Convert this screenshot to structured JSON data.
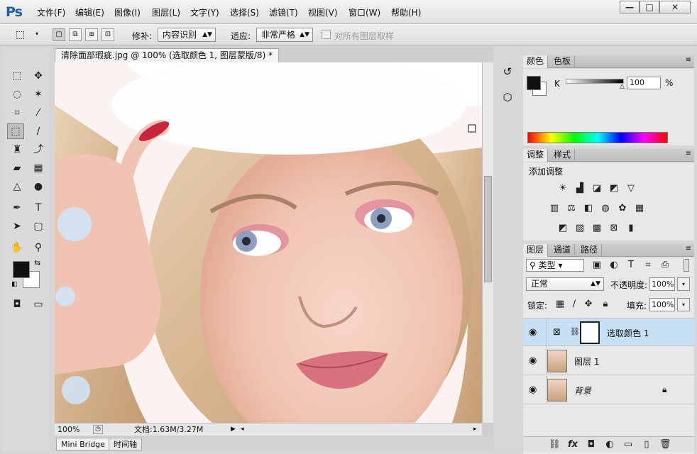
{
  "app": {
    "logo": "Ps"
  },
  "menu": [
    "文件(F)",
    "编辑(E)",
    "图像(I)",
    "图层(L)",
    "文字(Y)",
    "选择(S)",
    "滤镜(T)",
    "视图(V)",
    "窗口(W)",
    "帮助(H)"
  ],
  "window_controls": {
    "minimize": "—",
    "maximize": "□",
    "close": "✕"
  },
  "options": {
    "patch_label": "修补:",
    "patch_value": "内容识别",
    "adapt_label": "适应:",
    "adapt_value": "非常严格",
    "sample_all_label": "对所有图层取样"
  },
  "document": {
    "tab_title": "清除面部瑕疵.jpg @ 100% (选取颜色 1, 图层蒙版/8) *",
    "tab_close": "×",
    "zoom": "100%",
    "doc_info": "文档:1.63M/3.27M"
  },
  "bottom_tabs": [
    "Mini Bridge",
    "时间轴"
  ],
  "color_panel": {
    "tabs": [
      "颜色",
      "色板"
    ],
    "channel": "K",
    "value": "100",
    "unit": "%"
  },
  "adjust_panel": {
    "tabs": [
      "调整",
      "样式"
    ],
    "title": "添加调整"
  },
  "layers_panel": {
    "tabs": [
      "图层",
      "通道",
      "路径"
    ],
    "filter": "类型",
    "blend_mode": "正常",
    "opacity_label": "不透明度:",
    "opacity": "100%",
    "lock_label": "锁定:",
    "fill_label": "填充:",
    "fill": "100%",
    "layers": [
      {
        "name": "选取颜色 1",
        "selected": true
      },
      {
        "name": "图层 1",
        "selected": false
      },
      {
        "name": "背景",
        "selected": false,
        "locked": true
      }
    ],
    "footer_fx": "fx"
  },
  "colors": {
    "accent": "#1d5fa8",
    "selection": "#c7dff7"
  }
}
